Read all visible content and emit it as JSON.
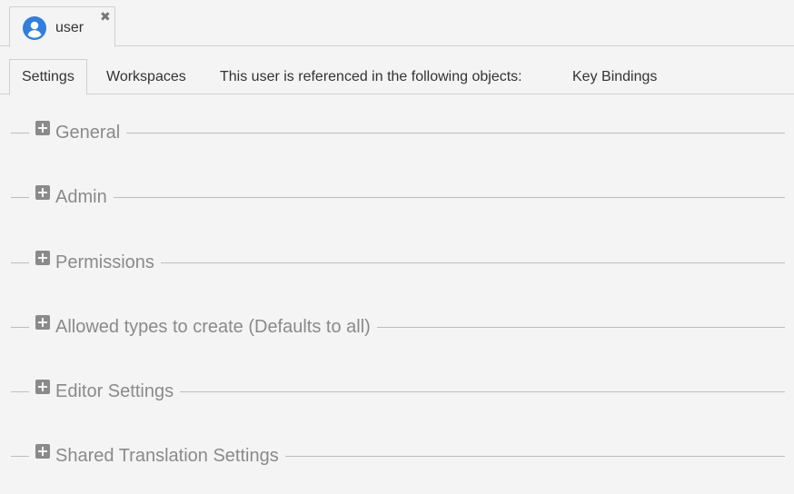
{
  "document_tab": {
    "label": "user",
    "icon": "user-avatar-icon",
    "icon_color": "#2f7ee0",
    "close_glyph": "✖"
  },
  "subtabs": [
    {
      "label": "Settings",
      "active": true
    },
    {
      "label": "Workspaces",
      "active": false
    },
    {
      "label": "This user is referenced in the following objects:",
      "active": false
    },
    {
      "label": "Key Bindings",
      "active": false
    }
  ],
  "sections": [
    {
      "label": "General",
      "icon": "plus-square-icon"
    },
    {
      "label": "Admin",
      "icon": "plus-square-icon"
    },
    {
      "label": "Permissions",
      "icon": "plus-square-icon"
    },
    {
      "label": "Allowed types to create (Defaults to all)",
      "icon": "plus-square-icon"
    },
    {
      "label": "Editor Settings",
      "icon": "plus-square-icon"
    },
    {
      "label": "Shared Translation Settings",
      "icon": "plus-square-icon"
    }
  ],
  "colors": {
    "background": "#f4f4f4",
    "border": "#d0d0d0",
    "section_text": "#8a8a8a",
    "plus_icon": "#8a8a8a"
  }
}
